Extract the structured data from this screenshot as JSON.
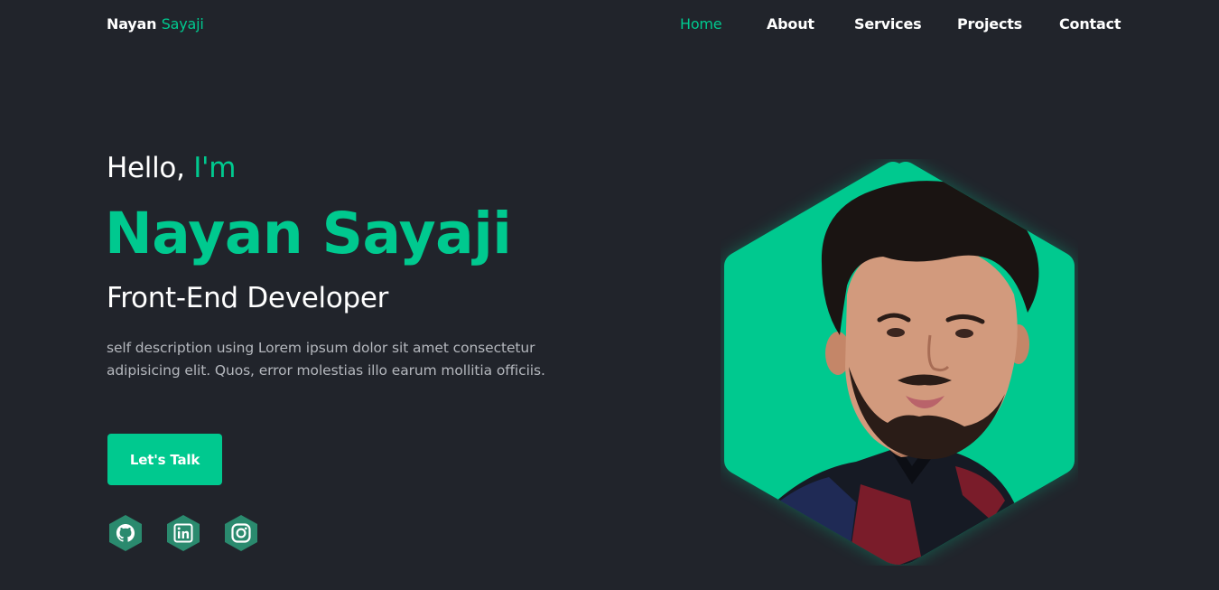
{
  "nav": {
    "logo_first": "Nayan",
    "logo_second": "Sayaji",
    "links": [
      {
        "label": "Home",
        "active": true
      },
      {
        "label": "About",
        "active": false
      },
      {
        "label": "Services",
        "active": false
      },
      {
        "label": "Projects",
        "active": false
      },
      {
        "label": "Contact",
        "active": false
      }
    ]
  },
  "hero": {
    "greeting_prefix": "Hello,",
    "greeting_accent": "I'm",
    "name": "Nayan Sayaji",
    "role": "Front-End Developer",
    "description": "self description using Lorem ipsum dolor sit amet consectetur adipisicing elit. Quos, error molestias illo earum mollitia officiis.",
    "cta_label": "Let's Talk"
  },
  "socials": [
    {
      "icon": "github-icon"
    },
    {
      "icon": "linkedin-icon"
    },
    {
      "icon": "instagram-icon"
    }
  ],
  "colors": {
    "background": "#21242b",
    "accent": "#00c98f",
    "social_bg": "#2a8a6e",
    "text_muted": "#b4b7bd"
  }
}
